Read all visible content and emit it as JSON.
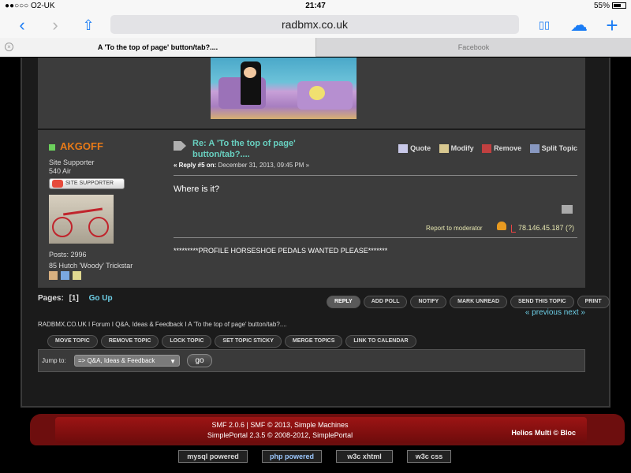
{
  "status_bar": {
    "carrier": "●●○○○ O2-UK ",
    "wifi": "wifi-icon",
    "time": "21:47",
    "battery": "55%"
  },
  "browser": {
    "url": "radbmx.co.uk",
    "back": "‹",
    "forward": "›",
    "share": "⇧",
    "bookmarks": "▯▯",
    "cloud": "☁",
    "new_tab": "+",
    "tabs": [
      {
        "label": "A 'To the top of page' button/tab?....",
        "active": true
      },
      {
        "label": "Facebook",
        "active": false
      }
    ],
    "tab_close": "×"
  },
  "post": {
    "poster_name": "AKGOFF",
    "poster_title": "Site Supporter",
    "poster_air": "540 Air",
    "badge": "SITE SUPPORTER",
    "posts": "Posts: 2996",
    "location": "85 Hutch 'Woody' Trickstar",
    "title": "Re: A 'To the top of page' button/tab?....",
    "reply_label": "« Reply #5 on:",
    "date": " December 31, 2013, 09:45 PM »",
    "actions": [
      "Quote",
      "Modify",
      "Remove",
      "Split Topic"
    ],
    "body": "Where is it?",
    "report": "Report to moderator",
    "ip": "78.146.45.187 (?)",
    "signature": "*********PROFILE HORSESHOE PEDALS WANTED PLEASE*******"
  },
  "pagination": {
    "pages_label": "Pages:",
    "current": "[1]",
    "go_up": "Go Up",
    "prev_next": "« previous next »"
  },
  "topic_buttons": [
    "REPLY",
    "ADD POLL",
    "NOTIFY",
    "MARK UNREAD",
    "SEND THIS TOPIC",
    "PRINT"
  ],
  "breadcrumb": "RADBMX.CO.UK  I  Forum  I  Q&A, Ideas & Feedback  I  A 'To the top of page' button/tab?....",
  "mod_buttons": [
    "MOVE TOPIC",
    "REMOVE TOPIC",
    "LOCK TOPIC",
    "SET TOPIC STICKY",
    "MERGE TOPICS",
    "LINK TO CALENDAR"
  ],
  "jump": {
    "label": "Jump to:",
    "selected": "=> Q&A, Ideas & Feedback",
    "go": "go"
  },
  "footer": {
    "line1": "SMF 2.0.6 | SMF © 2013, Simple Machines",
    "line2": "SimplePortal 2.3.5 © 2008-2012, SimplePortal",
    "theme": "Helios Multi © Bloc"
  },
  "badges": [
    "mysql powered",
    "php powered",
    "w3c xhtml",
    "w3c css"
  ],
  "colors": {
    "accent_name": "#e87a18",
    "link": "#6ed0e8",
    "title": "#68d0c0",
    "footer_red": "#9c1414"
  }
}
